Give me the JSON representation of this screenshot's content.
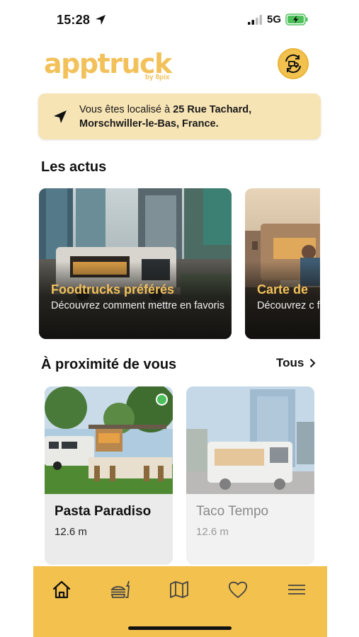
{
  "status_bar": {
    "time": "15:28",
    "network": "5G"
  },
  "header": {
    "logo": "apptruck",
    "logo_sub": "by 8pix"
  },
  "location": {
    "prefix": "Vous êtes localisé à ",
    "address": "25 Rue Tachard, Morschwiller-le-Bas, France."
  },
  "news": {
    "title": "Les actus",
    "cards": [
      {
        "title": "Foodtrucks préférés",
        "description": "Découvrez comment mettre en favoris"
      },
      {
        "title": "Carte de",
        "description": "Découvrez c fonctionne :"
      }
    ]
  },
  "nearby": {
    "title": "À proximité de vous",
    "see_all": "Tous",
    "items": [
      {
        "name": "Pasta Paradiso",
        "distance": "12.6 m",
        "open": true
      },
      {
        "name": "Taco Tempo",
        "distance": "12.6 m",
        "open": false
      }
    ]
  },
  "tabs": [
    "home-icon",
    "burger-icon",
    "map-icon",
    "heart-icon",
    "menu-icon"
  ],
  "colors": {
    "accent": "#f2c14e",
    "banner": "#f7e4b5",
    "card_title": "#f2c15a",
    "open_status": "#4cc05a"
  }
}
